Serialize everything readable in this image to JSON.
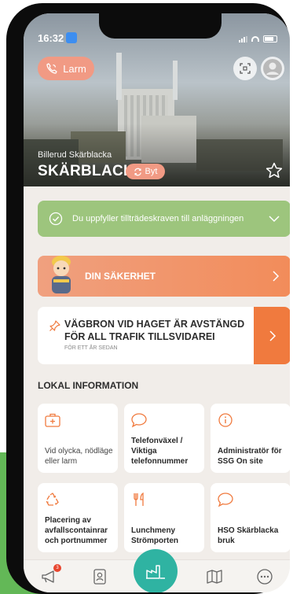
{
  "status_bar": {
    "time": "16:32"
  },
  "header": {
    "alarm_label": "Larm",
    "site_subtitle": "Billerud Skärblacka",
    "site_name": "SKÄRBLACKA",
    "switch_label": "Byt"
  },
  "access_card": {
    "text": "Du uppfyller tillträdeskraven till anläggningen"
  },
  "safety_card": {
    "text": "DIN SÄKERHET"
  },
  "news_card": {
    "title": "VÄGBRON VID HAGET ÄR AVSTÄNGD FÖR ALL TRAFIK TILLSVIDAREI",
    "date": "FÖR ETT ÅR SEDAN"
  },
  "local_info": {
    "title": "LOKAL INFORMATION",
    "tiles": [
      {
        "label": "Vid olycka, nödläge eller larm",
        "icon": "first-aid-icon"
      },
      {
        "label": "Telefonväxel / Viktiga telefonnummer",
        "icon": "chat-icon"
      },
      {
        "label": "Administratör för SSG On site",
        "icon": "info-icon"
      },
      {
        "label": "Placering av avfallscontainrar och portnummer",
        "icon": "recycle-icon"
      },
      {
        "label": "Lunchmeny Strömporten",
        "icon": "cutlery-icon"
      },
      {
        "label": "HSO Skärblacka bruk",
        "icon": "chat-icon"
      }
    ]
  },
  "bottom_nav": {
    "notification_count": "3",
    "items": [
      "megaphone-icon",
      "contacts-icon",
      "factory-icon",
      "map-icon",
      "more-icon"
    ]
  },
  "colors": {
    "accent_orange": "#f07a3e",
    "green": "#9dc57d",
    "teal": "#2fb3a2",
    "salmon": "#f19a84"
  }
}
